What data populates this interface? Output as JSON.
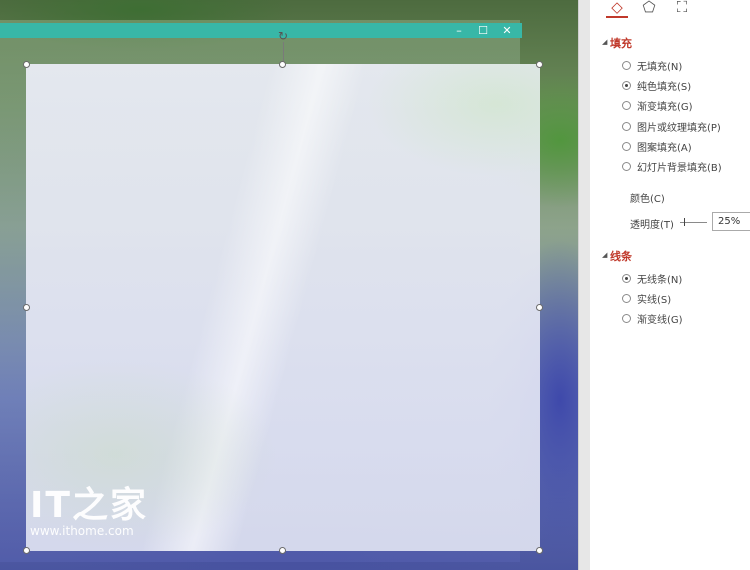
{
  "window": {
    "controls": {
      "minimize": "–",
      "maximize": "☐",
      "close": "✕"
    },
    "rotate_symbol": "↻"
  },
  "watermark": {
    "logo": "IT之家",
    "url": "www.ithome.com"
  },
  "panel": {
    "tabs": [
      {
        "icon": "fill-bucket-icon",
        "symbol": "◇",
        "active": true
      },
      {
        "icon": "pentagon-effects-icon",
        "symbol": "⬠",
        "active": false
      },
      {
        "icon": "size-layout-icon",
        "symbol": "⛶",
        "active": false
      }
    ],
    "fill": {
      "title": "填充",
      "options": [
        {
          "label": "无填充(N)",
          "checked": false
        },
        {
          "label": "纯色填充(S)",
          "checked": true
        },
        {
          "label": "渐变填充(G)",
          "checked": false
        },
        {
          "label": "图片或纹理填充(P)",
          "checked": false
        },
        {
          "label": "图案填充(A)",
          "checked": false
        },
        {
          "label": "幻灯片背景填充(B)",
          "checked": false
        }
      ],
      "color_label": "颜色(C)",
      "transparency_label": "透明度(T)",
      "transparency_value": "25%",
      "transparency_level": 0.25
    },
    "line": {
      "title": "线条",
      "options": [
        {
          "label": "无线条(N)",
          "checked": true
        },
        {
          "label": "实线(S)",
          "checked": false
        },
        {
          "label": "渐变线(G)",
          "checked": false
        }
      ]
    }
  },
  "colors": {
    "accent": "#c0392b",
    "titlebar": "#38b7a7"
  }
}
